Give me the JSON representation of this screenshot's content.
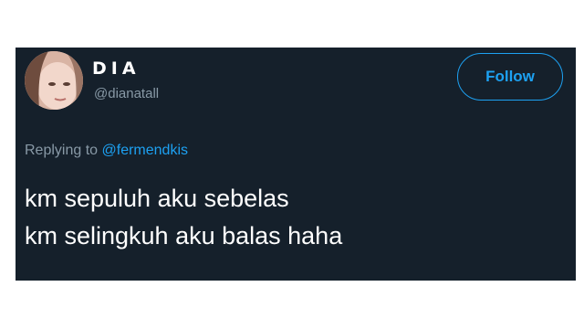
{
  "tweet": {
    "display_name": "DIA",
    "handle": "@dianatall",
    "follow_label": "Follow",
    "reply_prefix": "Replying to ",
    "reply_mention": "@fermendkis",
    "text_lines": [
      "km sepuluh aku sebelas",
      "km selingkuh aku balas haha"
    ]
  },
  "colors": {
    "card_background": "#15202b",
    "accent": "#1da1f2",
    "secondary_text": "#8899a6",
    "primary_text": "#ffffff"
  },
  "icons": {
    "avatar": "profile-photo"
  }
}
